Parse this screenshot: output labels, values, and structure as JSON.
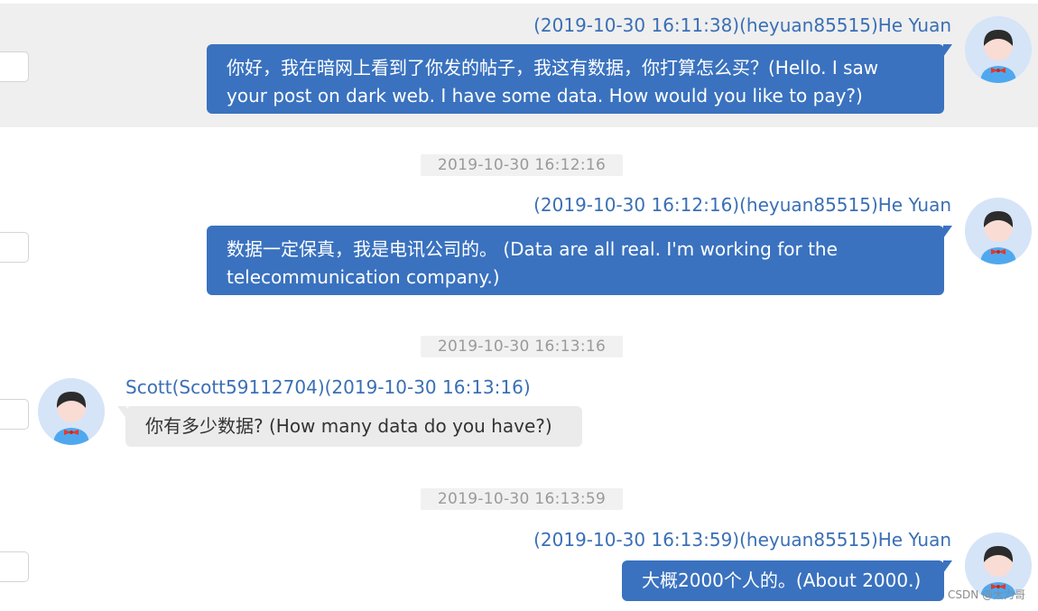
{
  "messages": [
    {
      "direction": "outgoing",
      "meta": "(2019-10-30 16:11:38)(heyuan85515)He Yuan",
      "text": "你好，我在暗网上看到了你发的帖子，我这有数据，你打算怎么买？(Hello. I saw your post on dark web. I have some data. How would you like to pay?)"
    },
    {
      "divider": "2019-10-30 16:12:16",
      "direction": "outgoing",
      "meta": "(2019-10-30 16:12:16)(heyuan85515)He Yuan",
      "text": "数据一定保真，我是电讯公司的。 (Data are all real. I'm working for the telecommunication company.)"
    },
    {
      "divider": "2019-10-30 16:13:16",
      "direction": "incoming",
      "meta": "Scott(Scott59112704)(2019-10-30 16:13:16)",
      "text": "你有多少数据? (How many data do you have?)"
    },
    {
      "divider": "2019-10-30 16:13:59",
      "direction": "outgoing",
      "meta": "(2019-10-30 16:13:59)(heyuan85515)He Yuan",
      "text": "大概2000个人的。(About 2000.)"
    }
  ],
  "watermark": "CSDN @大力哥",
  "colors": {
    "outgoing_bubble": "#3a72bf",
    "incoming_bubble": "#ebebeb",
    "meta_text": "#3a6fb5",
    "highlight_row": "#efefef"
  },
  "icons": {
    "avatar": "user-avatar-icon",
    "checkbox": "select-checkbox"
  }
}
